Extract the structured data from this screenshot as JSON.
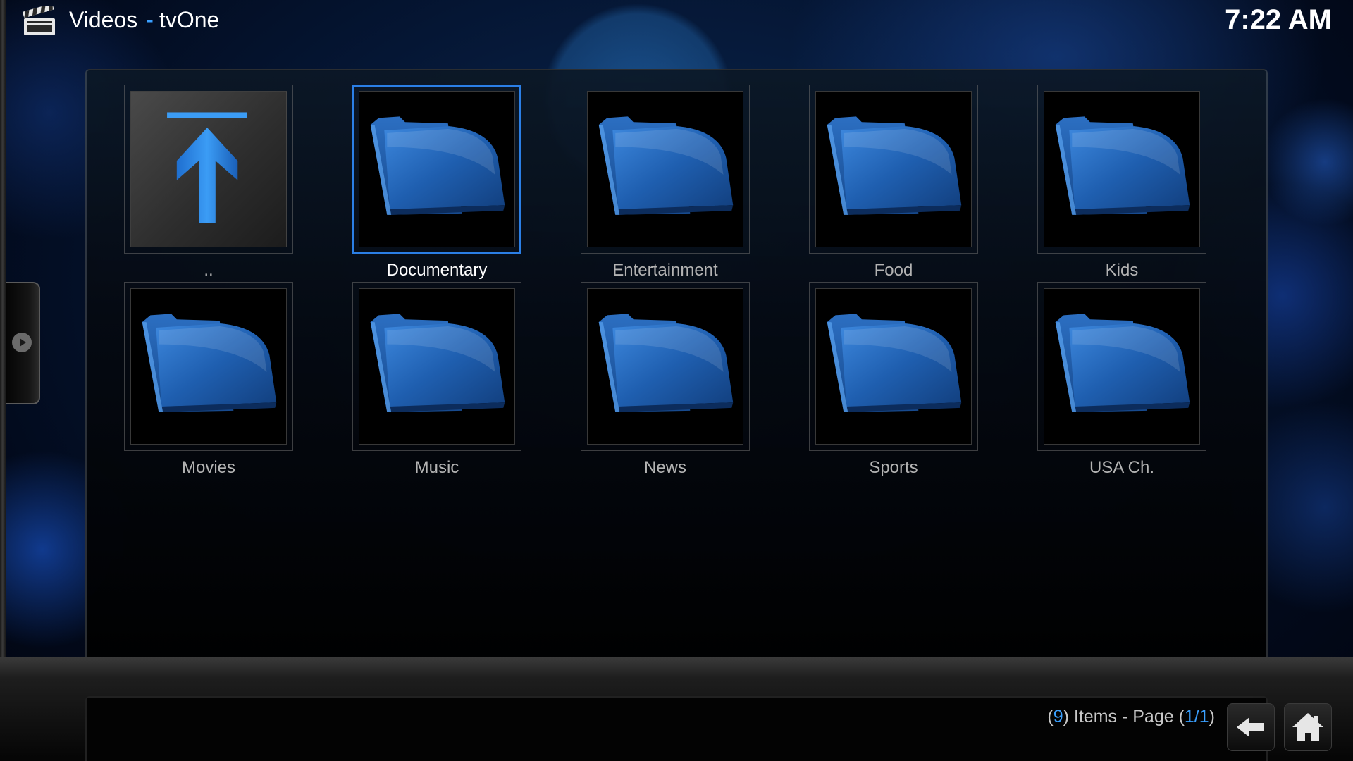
{
  "header": {
    "section": "Videos",
    "separator": "-",
    "source": "tvOne",
    "icon": "clapperboard-icon"
  },
  "clock": "7:22 AM",
  "grid": {
    "items": [
      {
        "label": "..",
        "kind": "parent"
      },
      {
        "label": "Documentary",
        "kind": "folder",
        "focused": true
      },
      {
        "label": "Entertainment",
        "kind": "folder"
      },
      {
        "label": "Food",
        "kind": "folder"
      },
      {
        "label": "Kids",
        "kind": "folder"
      },
      {
        "label": "Movies",
        "kind": "folder"
      },
      {
        "label": "Music",
        "kind": "folder"
      },
      {
        "label": "News",
        "kind": "folder"
      },
      {
        "label": "Sports",
        "kind": "folder"
      },
      {
        "label": "USA Ch.",
        "kind": "folder"
      }
    ]
  },
  "status": {
    "open1": "(",
    "count": "9",
    "mid": ") Items - Page (",
    "page": "1/1",
    "close": ")"
  },
  "buttons": {
    "back_icon": "back-arrow-icon",
    "home_icon": "home-icon"
  },
  "colors": {
    "accent": "#3aa0ff",
    "focus_border": "#2b7fe6",
    "folder_blue": "#1f5fb0"
  }
}
